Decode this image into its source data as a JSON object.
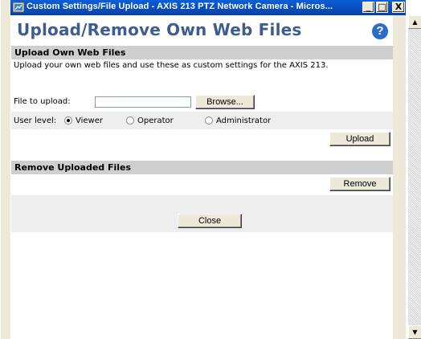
{
  "window": {
    "title": "Custom Settings/File Upload - AXIS 213 PTZ Network Camera - Micros...",
    "minimize_label": "_",
    "maximize_label": "□",
    "close_label": "X"
  },
  "page": {
    "title": "Upload/Remove Own Web Files",
    "help_label": "?"
  },
  "upload_section": {
    "header": "Upload Own Web Files",
    "description": "Upload your own web files and use these as custom settings for the AXIS 213.",
    "file_label": "File to upload:",
    "file_value": "",
    "browse_label": "Browse...",
    "user_level_label": "User level:",
    "levels": [
      "Viewer",
      "Operator",
      "Administrator"
    ],
    "selected_level": "Viewer",
    "upload_label": "Upload"
  },
  "remove_section": {
    "header": "Remove Uploaded Files",
    "remove_label": "Remove"
  },
  "footer": {
    "close_label": "Close"
  },
  "scrollbar": {
    "up_arrow": "▲",
    "down_arrow": "▼"
  }
}
